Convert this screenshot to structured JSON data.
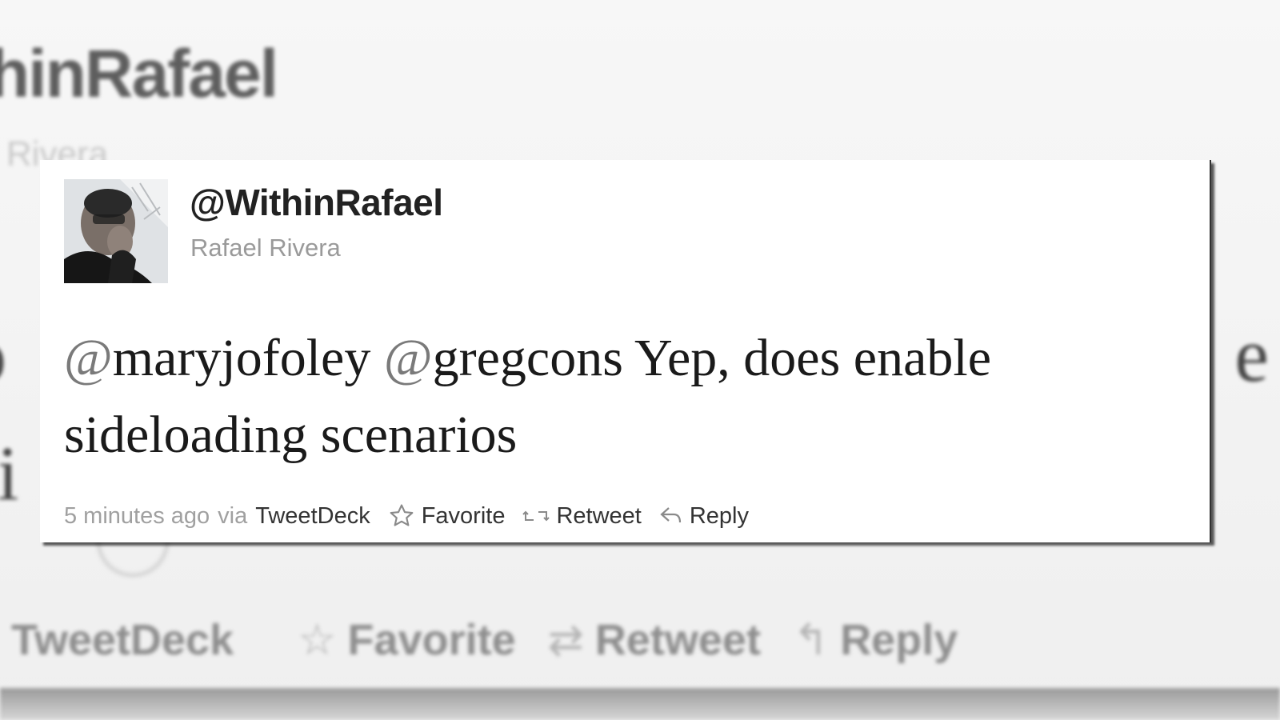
{
  "background": {
    "username": "thinRafael",
    "fullname": "Rivera",
    "text_line1": "o",
    "text_line2": "li",
    "text_line1_tail": "e",
    "source": "TweetDeck",
    "favorite": "Favorite",
    "retweet": "Retweet",
    "reply": "Reply"
  },
  "tweet": {
    "username": "@WithinRafael",
    "fullname": "Rafael Rivera",
    "mention1": "maryjofoley",
    "mention2": "gregcons",
    "text_rest": " Yep, does enable sideloading scenarios",
    "timestamp": "5 minutes ago",
    "via_label": "via",
    "source": "TweetDeck",
    "actions": {
      "favorite": "Favorite",
      "retweet": "Retweet",
      "reply": "Reply"
    }
  },
  "icons": {
    "favorite": "star-icon",
    "retweet": "retweet-icon",
    "reply": "reply-icon"
  },
  "colors": {
    "card_bg": "#ffffff",
    "text": "#1a1a1a",
    "muted": "#9a9a9a"
  }
}
